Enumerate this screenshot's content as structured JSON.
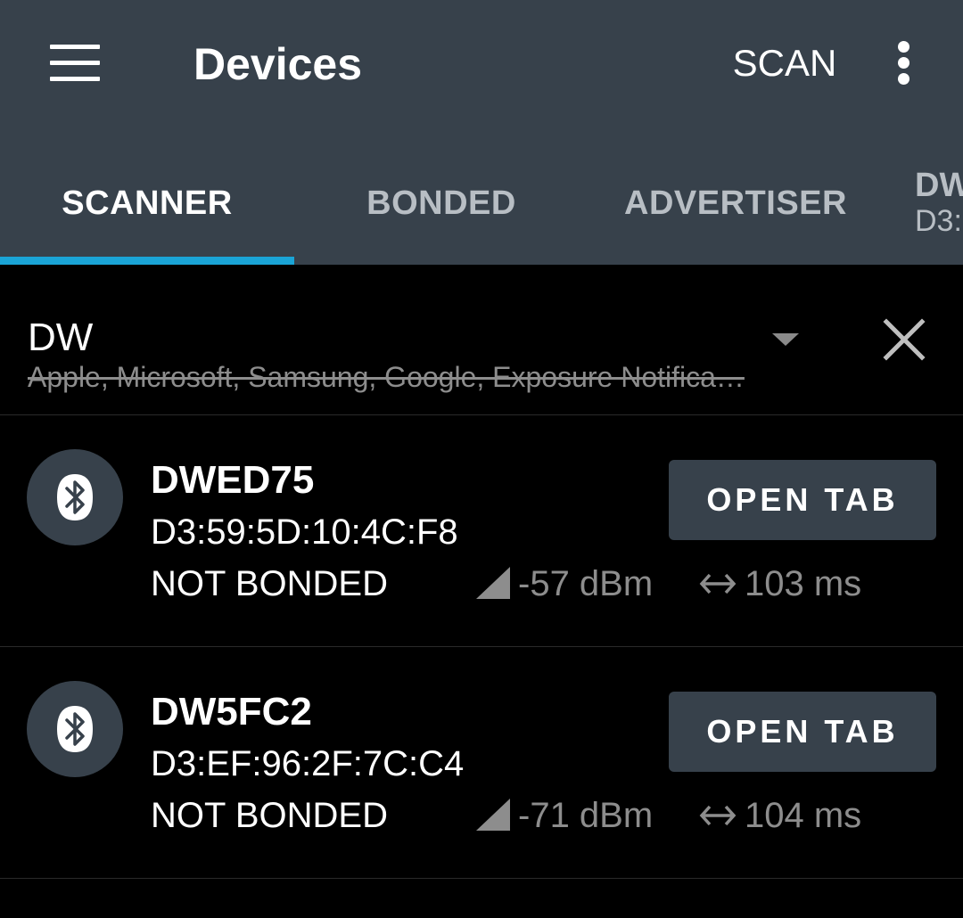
{
  "appbar": {
    "title": "Devices",
    "scan_label": "SCAN",
    "background_color": "#37414b"
  },
  "tabs": [
    {
      "label": "SCANNER",
      "active": true
    },
    {
      "label": "BONDED",
      "active": false
    },
    {
      "label": "ADVERTISER",
      "active": false
    },
    {
      "label": "DW",
      "sublabel": "D3:",
      "active": false
    }
  ],
  "accent_color": "#1aa4d6",
  "filter": {
    "text": "DW",
    "excluded": "Apple, Microsoft, Samsung, Google, Exposure Notifica…"
  },
  "devices": [
    {
      "name": "DWED75",
      "address": "D3:59:5D:10:4C:F8",
      "bond_state": "NOT BONDED",
      "rssi": "-57 dBm",
      "interval": "103 ms",
      "action_label": "OPEN TAB"
    },
    {
      "name": "DW5FC2",
      "address": "D3:EF:96:2F:7C:C4",
      "bond_state": "NOT BONDED",
      "rssi": "-71 dBm",
      "interval": "104 ms",
      "action_label": "OPEN TAB"
    }
  ],
  "icons": {
    "menu": "hamburger-menu-icon",
    "overflow": "more-vert-icon",
    "dropdown": "arrow-drop-down-icon",
    "clear": "close-icon",
    "device": "bluetooth-icon",
    "signal": "signal-strength-icon",
    "interval": "swap-horiz-icon"
  }
}
